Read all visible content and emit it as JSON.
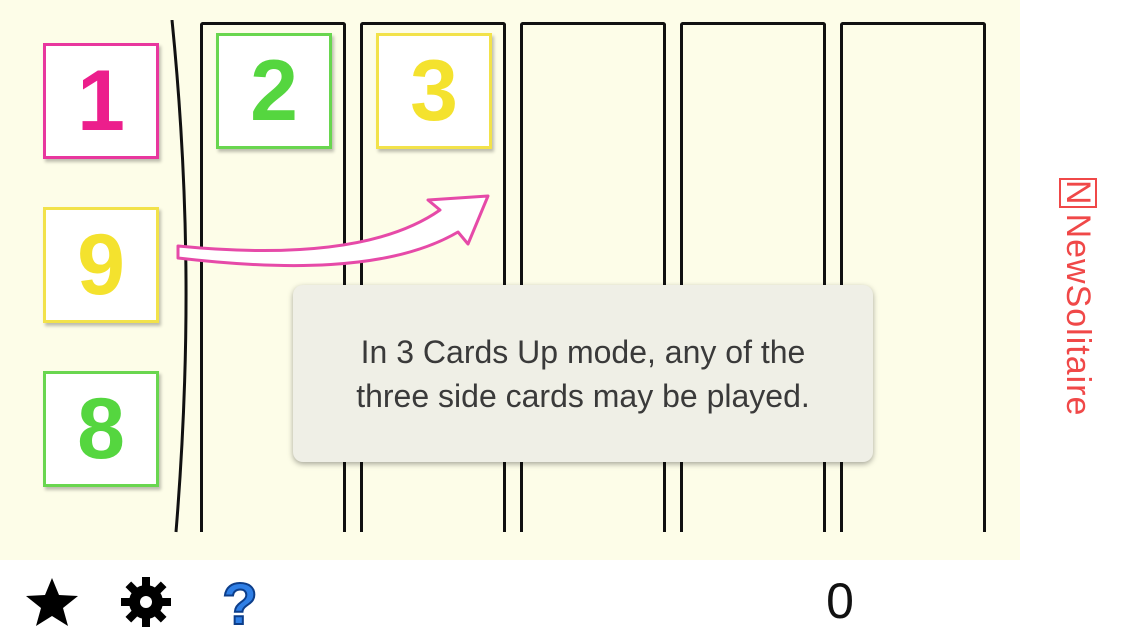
{
  "side_cards": [
    {
      "value": "1",
      "color": "#ec1e8c"
    },
    {
      "value": "9",
      "color": "#f4e22e"
    },
    {
      "value": "8",
      "color": "#55d63f"
    }
  ],
  "column_cards": [
    {
      "value": "2",
      "color": "#55d63f"
    },
    {
      "value": "3",
      "color": "#f4e22e"
    }
  ],
  "tooltip": {
    "text": "In 3 Cards Up mode, any of the three side cards may be played."
  },
  "brand": {
    "box_letter": "N",
    "name": "NewSolitaire",
    "color": "#f04848"
  },
  "toolbar": {
    "star_icon": "star-icon",
    "settings_icon": "gear-icon",
    "help_icon": "question-icon",
    "score": "0"
  }
}
